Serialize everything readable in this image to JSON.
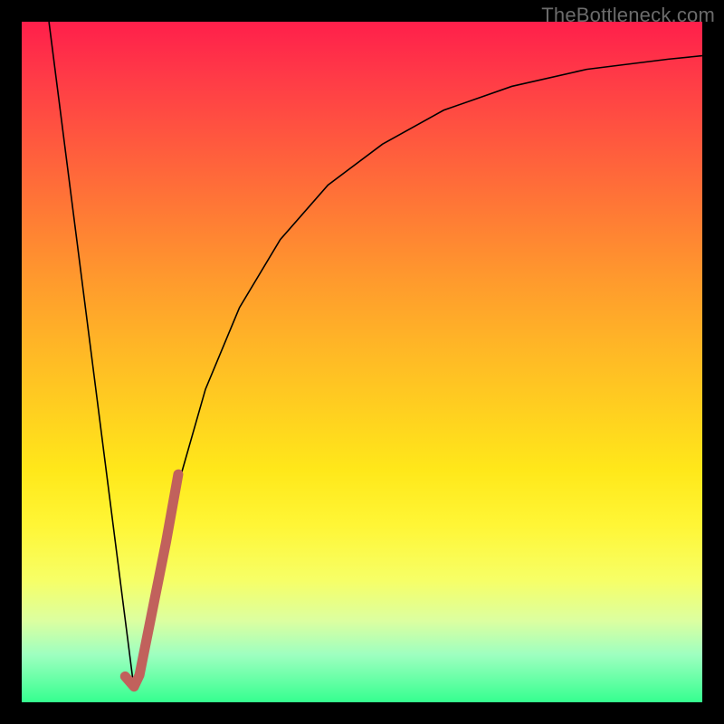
{
  "watermark": "TheBottleneck.com",
  "chart_data": {
    "type": "line",
    "title": "",
    "xlabel": "",
    "ylabel": "",
    "xlim": [
      0,
      100
    ],
    "ylim": [
      0,
      100
    ],
    "grid": false,
    "legend": false,
    "annotations": [],
    "series": [
      {
        "name": "left-descent",
        "stroke": "#000000",
        "stroke_width": 1.6,
        "x": [
          4,
          16.5
        ],
        "y": [
          100,
          2
        ]
      },
      {
        "name": "right-curve",
        "stroke": "#000000",
        "stroke_width": 1.6,
        "x": [
          16.5,
          18,
          20,
          23,
          27,
          32,
          38,
          45,
          53,
          62,
          72,
          83,
          95,
          100
        ],
        "y": [
          2,
          9,
          19,
          32,
          46,
          58,
          68,
          76,
          82,
          87,
          90.5,
          93,
          94.5,
          95
        ]
      },
      {
        "name": "highlight-hook",
        "stroke": "#c1615c",
        "stroke_width": 11,
        "linecap": "round",
        "x": [
          15.2,
          16.5,
          17.3,
          19.0,
          21.2,
          23.0
        ],
        "y": [
          3.8,
          2.3,
          4.0,
          12.5,
          23.5,
          33.5
        ]
      }
    ],
    "background_gradient": {
      "type": "linear-vertical",
      "stops": [
        {
          "pos": 0.0,
          "color": "#ff1f4b"
        },
        {
          "pos": 0.5,
          "color": "#ffb726"
        },
        {
          "pos": 0.75,
          "color": "#fff636"
        },
        {
          "pos": 1.0,
          "color": "#35ff8f"
        }
      ]
    }
  }
}
